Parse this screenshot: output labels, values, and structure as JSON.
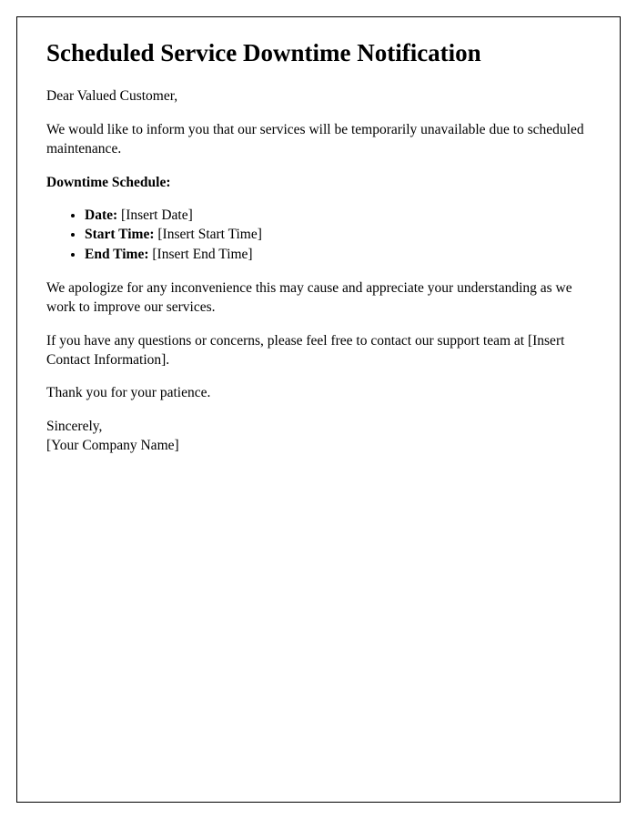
{
  "title": "Scheduled Service Downtime Notification",
  "greeting": "Dear Valued Customer,",
  "intro": "We would like to inform you that our services will be temporarily unavailable due to scheduled maintenance.",
  "schedule_heading": "Downtime Schedule:",
  "schedule": [
    {
      "label": "Date:",
      "value": " [Insert Date]"
    },
    {
      "label": "Start Time:",
      "value": " [Insert Start Time]"
    },
    {
      "label": "End Time:",
      "value": " [Insert End Time]"
    }
  ],
  "apology": "We apologize for any inconvenience this may cause and appreciate your understanding as we work to improve our services.",
  "contact": "If you have any questions or concerns, please feel free to contact our support team at [Insert Contact Information].",
  "thanks": "Thank you for your patience.",
  "closing": "Sincerely,",
  "company": "[Your Company Name]"
}
